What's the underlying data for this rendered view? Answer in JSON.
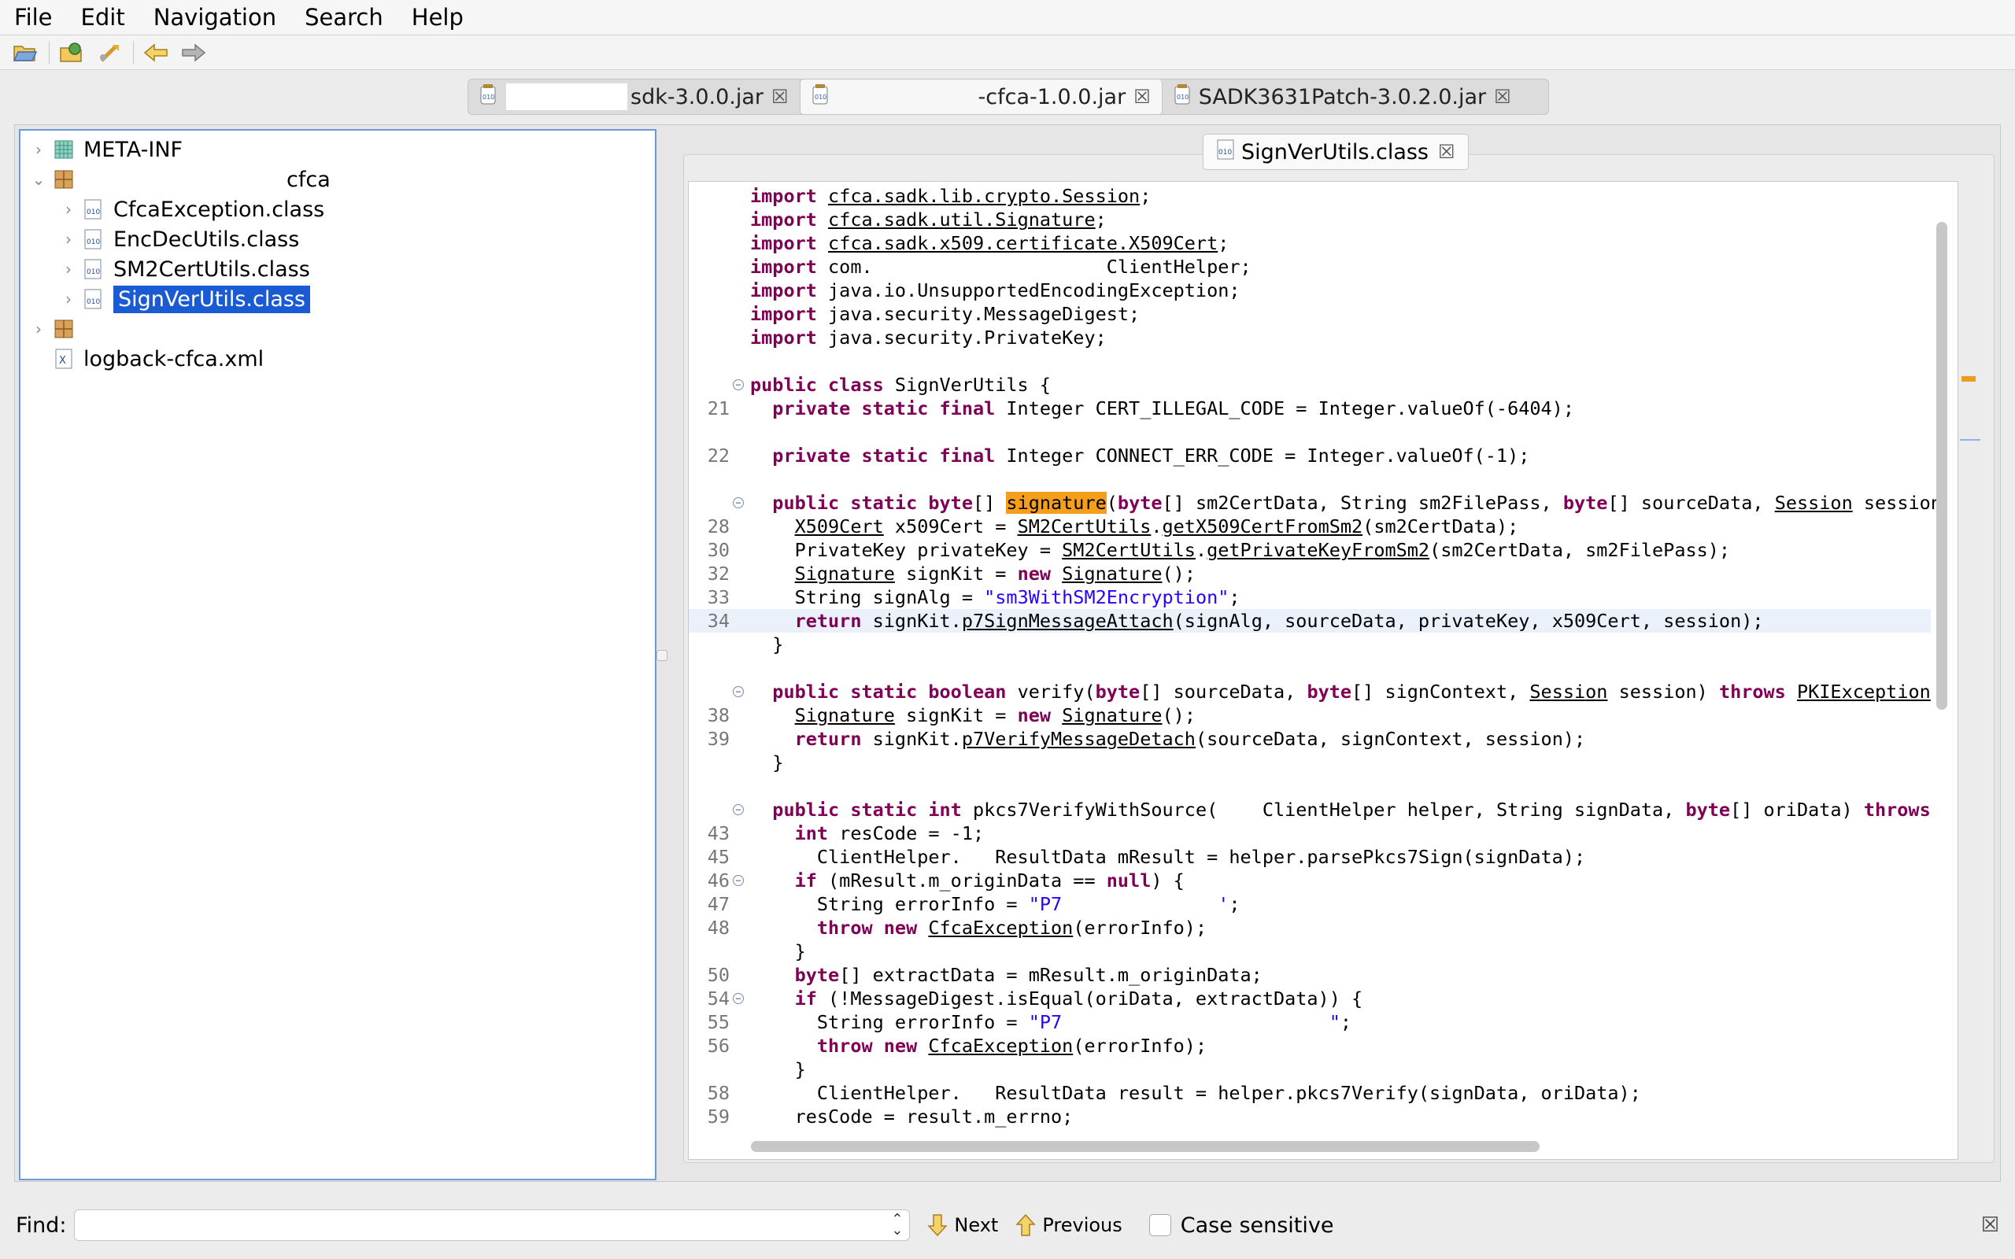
{
  "menu": [
    "File",
    "Edit",
    "Navigation",
    "Search",
    "Help"
  ],
  "jar_tabs": [
    {
      "label": "sdk-3.0.0.jar",
      "active": false
    },
    {
      "label": "-cfca-1.0.0.jar",
      "active": true
    },
    {
      "label": "SADK3631Patch-3.0.2.0.jar",
      "active": false
    }
  ],
  "tree": [
    {
      "label": "META-INF",
      "icon": "package-folder-icon",
      "expandable": true
    },
    {
      "label": "cfca",
      "icon": "package-icon",
      "expandable": true,
      "expanded": true
    },
    {
      "label": "CfcaException.class",
      "icon": "class-file-icon",
      "expandable": true
    },
    {
      "label": "EncDecUtils.class",
      "icon": "class-file-icon",
      "expandable": true
    },
    {
      "label": "SM2CertUtils.class",
      "icon": "class-file-icon",
      "expandable": true
    },
    {
      "label": "SignVerUtils.class",
      "icon": "class-file-icon",
      "expandable": true,
      "selected": true
    },
    {
      "label": "",
      "icon": "package-icon",
      "expandable": true
    },
    {
      "label": "logback-cfca.xml",
      "icon": "xml-file-icon",
      "expandable": false
    }
  ],
  "editor_tab": {
    "label": "SignVerUtils.class"
  },
  "code_lines": [
    {
      "n": "",
      "fold": false,
      "html": "<span class='kw'>import</span> <span class='u'>cfca.sadk.lib.crypto.Session</span>;"
    },
    {
      "n": "",
      "fold": false,
      "html": "<span class='kw'>import</span> <span class='u'>cfca.sadk.util.Signature</span>;"
    },
    {
      "n": "",
      "fold": false,
      "html": "<span class='kw'>import</span> <span class='u'>cfca.sadk.x509.certificate.X509Cert</span>;"
    },
    {
      "n": "",
      "fold": false,
      "html": "<span class='kw'>import</span> com.                     ClientHelper;"
    },
    {
      "n": "",
      "fold": false,
      "html": "<span class='kw'>import</span> java.io.UnsupportedEncodingException;"
    },
    {
      "n": "",
      "fold": false,
      "html": "<span class='kw'>import</span> java.security.MessageDigest;"
    },
    {
      "n": "",
      "fold": false,
      "html": "<span class='kw'>import</span> java.security.PrivateKey;"
    },
    {
      "n": "",
      "fold": false,
      "html": ""
    },
    {
      "n": "",
      "fold": true,
      "html": "<span class='kw'>public class</span> SignVerUtils {"
    },
    {
      "n": "21",
      "fold": false,
      "html": "  <span class='kw'>private static final</span> Integer CERT_ILLEGAL_CODE = Integer.valueOf(-6404);"
    },
    {
      "n": "",
      "fold": false,
      "html": ""
    },
    {
      "n": "22",
      "fold": false,
      "html": "  <span class='kw'>private static final</span> Integer CONNECT_ERR_CODE = Integer.valueOf(-1);"
    },
    {
      "n": "",
      "fold": false,
      "html": ""
    },
    {
      "n": "",
      "fold": true,
      "html": "  <span class='kw'>public static byte</span>[] <span class='match'>signature</span>(<span class='kw'>byte</span>[] sm2CertData, String sm2FilePass, <span class='kw'>byte</span>[] sourceData, <span class='u'>Session</span> session"
    },
    {
      "n": "28",
      "fold": false,
      "html": "    <span class='u'>X509Cert</span> x509Cert = <span class='u'>SM2CertUtils</span>.<span class='u'>getX509CertFromSm2</span>(sm2CertData);"
    },
    {
      "n": "30",
      "fold": false,
      "html": "    PrivateKey privateKey = <span class='u'>SM2CertUtils</span>.<span class='u'>getPrivateKeyFromSm2</span>(sm2CertData, sm2FilePass);"
    },
    {
      "n": "32",
      "fold": false,
      "html": "    <span class='u'>Signature</span> signKit = <span class='kw'>new</span> <span class='u'>Signature</span>();"
    },
    {
      "n": "33",
      "fold": false,
      "html": "    String signAlg = <span class='str'>\"sm3WithSM2Encryption\"</span>;"
    },
    {
      "n": "34",
      "fold": false,
      "hl": true,
      "html": "    <span class='kw'>return</span> signKit.<span class='u'>p7SignMessageAttach</span>(signAlg, sourceData, privateKey, x509Cert, session);"
    },
    {
      "n": "",
      "fold": false,
      "html": "  }"
    },
    {
      "n": "",
      "fold": false,
      "html": ""
    },
    {
      "n": "",
      "fold": true,
      "html": "  <span class='kw'>public static boolean</span> verify(<span class='kw'>byte</span>[] sourceData, <span class='kw'>byte</span>[] signContext, <span class='u'>Session</span> session) <span class='kw'>throws</span> <span class='u'>PKIException</span> "
    },
    {
      "n": "38",
      "fold": false,
      "html": "    <span class='u'>Signature</span> signKit = <span class='kw'>new</span> <span class='u'>Signature</span>();"
    },
    {
      "n": "39",
      "fold": false,
      "html": "    <span class='kw'>return</span> signKit.<span class='u'>p7VerifyMessageDetach</span>(sourceData, signContext, session);"
    },
    {
      "n": "",
      "fold": false,
      "html": "  }"
    },
    {
      "n": "",
      "fold": false,
      "html": ""
    },
    {
      "n": "",
      "fold": true,
      "html": "  <span class='kw'>public static int</span> pkcs7VerifyWithSource(    ClientHelper helper, String signData, <span class='kw'>byte</span>[] oriData) <span class='kw'>throws</span> "
    },
    {
      "n": "43",
      "fold": false,
      "html": "    <span class='kw'>int</span> resCode = -1;"
    },
    {
      "n": "45",
      "fold": false,
      "html": "      ClientHelper.   ResultData mResult = helper.parsePkcs7Sign(signData);"
    },
    {
      "n": "46",
      "fold": true,
      "html": "    <span class='kw'>if</span> (mResult.m_originData == <span class='kw'>null</span>) {"
    },
    {
      "n": "47",
      "fold": false,
      "html": "      String errorInfo = <span class='str'>\"P7              '</span>;"
    },
    {
      "n": "48",
      "fold": false,
      "html": "      <span class='kw'>throw new</span> <span class='u'>CfcaException</span>(errorInfo);"
    },
    {
      "n": "",
      "fold": false,
      "html": "    }"
    },
    {
      "n": "50",
      "fold": false,
      "html": "    <span class='kw'>byte</span>[] extractData = mResult.m_originData;"
    },
    {
      "n": "54",
      "fold": true,
      "html": "    <span class='kw'>if</span> (!MessageDigest.isEqual(oriData, extractData)) {"
    },
    {
      "n": "55",
      "fold": false,
      "html": "      String errorInfo = <span class='str'>\"P7                        \"</span>;"
    },
    {
      "n": "56",
      "fold": false,
      "html": "      <span class='kw'>throw new</span> <span class='u'>CfcaException</span>(errorInfo);"
    },
    {
      "n": "",
      "fold": false,
      "html": "    }"
    },
    {
      "n": "58",
      "fold": false,
      "html": "      ClientHelper.   ResultData result = helper.pkcs7Verify(signData, oriData);"
    },
    {
      "n": "59",
      "fold": false,
      "html": "    resCode = result.m_errno;"
    }
  ],
  "find": {
    "label": "Find:",
    "value": "",
    "next_label": "Next",
    "previous_label": "Previous",
    "case_label": "Case sensitive"
  },
  "colors": {
    "selection": "#1a5bd4",
    "keyword": "#7f0055",
    "string": "#2a00ff",
    "match": "#f59e1b"
  }
}
